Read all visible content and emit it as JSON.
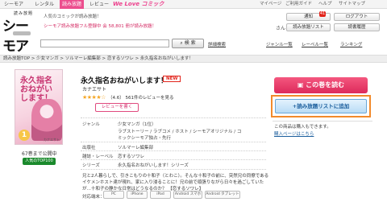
{
  "topnav": {
    "items": [
      "シーモア",
      "レンタル",
      "読み放題",
      "レビュー"
    ],
    "active_index": 2,
    "brand_banner": "We Love コミック",
    "right_links": [
      "マイページ",
      "ご利用ガイド",
      "ヘルプ",
      "サイトマップ"
    ]
  },
  "header": {
    "logo_small": "読み放題",
    "logo_main": "シーモア",
    "promo_line1": "人気のコミックが読み放題！",
    "promo_line2": "シーモア読み放題フル登録中 会 58,801 冊が読み放題！",
    "user_suffix": "さん",
    "notify_label": "通知",
    "notify_count": "41",
    "logout_label": "ログアウト",
    "readlist_label": "読み放題リスト",
    "history_label": "読書履歴",
    "search_placeholder": "",
    "search_button": "検 索",
    "detail_search": "詳細検索",
    "genre_list": "ジャンル一覧",
    "label_list": "レーベル一覧",
    "ranking": "ランキング"
  },
  "breadcrumb": "読み放題TOP  >  少女マンガ  >  ソルマーレ編集部  >  恋するソワレ  >  永久指名おねがいします！",
  "book": {
    "cover_title": "永久指名おねがいします！",
    "cover_volume": "1",
    "cover_author": "カナエサト",
    "free_caption": "67巻まで公開中",
    "rank_badge": "人気のTOP100",
    "title": "永久指名おねがいします！",
    "new_badge": "NEW",
    "author": "カナエサト",
    "stars": "★★★★☆",
    "rating_text": "（4.6）  561件のレビューを見る",
    "review_button": "レビューを書く",
    "meta": [
      {
        "key": "ジャンル",
        "value": "少女マンガ（1位）"
      },
      {
        "key": "",
        "value": "ラブストーリー / ラブコメ / ホスト / シーモアオリジナル / コ"
      },
      {
        "key": "",
        "value": "ミックシーモア独占・先行"
      },
      {
        "key": "出版社",
        "value": "ソルマーレ編集部"
      },
      {
        "key": "雑誌・レーベル",
        "value": "恋するソワレ"
      },
      {
        "key": "シリーズ",
        "value": "永久指名おねがいします！シリーズ"
      }
    ],
    "description": "兄と2人暮らしで、引きこもりの十和子（とわこ）。そんな十和子の前に、突然兄の同僚であるイケメンホスト達が現れ、家に入り浸ることに！兄の前で頑張りながら日々を過ごしていたが…十和子の静かな日常はどうなるのか？ 【恋するソワレ】",
    "devices_label": "対応端末：",
    "devices": [
      "PC",
      "iPhone",
      "iPad",
      "Android スマホ",
      "Android タブレット"
    ]
  },
  "actions": {
    "read_button": "この巻を読む",
    "add_button": "+読み放題リストに追加",
    "purchase_note": "この商品は購入もできます。",
    "purchase_link": "購入ページはこちら"
  },
  "colors": {
    "accent_pink": "#e2316b",
    "highlight_orange": "#f28a2c",
    "add_blue": "#1a5d9c"
  }
}
